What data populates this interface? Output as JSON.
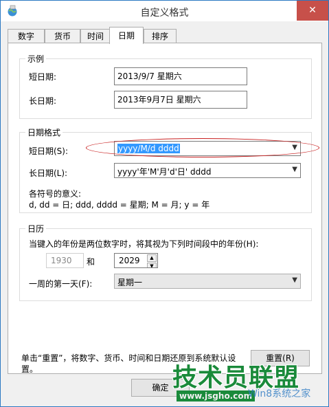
{
  "window": {
    "title": "自定义格式",
    "close_icon": "✕"
  },
  "tabs": [
    "数字",
    "货币",
    "时间",
    "日期",
    "排序"
  ],
  "active_tab": "日期",
  "example": {
    "title": "示例",
    "short_label": "短日期:",
    "short_value": "2013/9/7 星期六",
    "long_label": "长日期:",
    "long_value": "2013年9月7日 星期六"
  },
  "date_format": {
    "title": "日期格式",
    "short_label": "短日期(S):",
    "short_value": "yyyy/M/d dddd",
    "long_label": "长日期(L):",
    "long_value": "yyyy'年'M'月'd'日' dddd",
    "meaning_title": "各符号的意义:",
    "meaning_text": "d, dd = 日;  ddd, dddd = 星期;  M = 月;  y = 年"
  },
  "calendar": {
    "title": "日历",
    "desc": "当键入的年份是两位数字时，将其视为下列时间段中的年份(H):",
    "year_from": "1930",
    "and_label": "和",
    "year_to": "2029",
    "first_day_label": "一周的第一天(F):",
    "first_day_value": "星期一"
  },
  "footer": {
    "reset_desc_line1": "单击“重置”，将数字、货币、时间和日期还原到系统默认设",
    "reset_desc_line2": "置。",
    "reset_button": "重置(R)",
    "ok_button": "确定"
  },
  "watermark": {
    "brand": "技术员联盟",
    "url": "www.jsgho.com",
    "right_text": "Win8系统之家"
  },
  "colors": {
    "highlight": "#3399ff",
    "close": "#c7504a",
    "annotation": "#c81e1e",
    "watermark": "#1a8a3a"
  }
}
